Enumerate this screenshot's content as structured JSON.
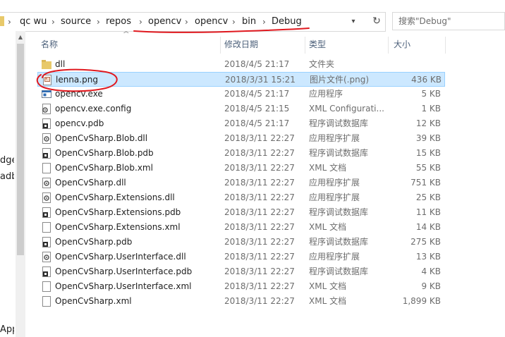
{
  "breadcrumb": [
    "qc wu",
    "source",
    "repos",
    "opencv",
    "opencv",
    "bin",
    "Debug"
  ],
  "search": {
    "placeholder": "搜索\"Debug\""
  },
  "left_pane": {
    "fragments": [
      "dge",
      "adb",
      "App"
    ]
  },
  "columns": {
    "name": "名称",
    "date": "修改日期",
    "type": "类型",
    "size": "大小"
  },
  "files": [
    {
      "name": "dll",
      "date": "2018/4/5 21:17",
      "type": "文件夹",
      "size": "",
      "icon": "folder-icon"
    },
    {
      "name": "lenna.png",
      "date": "2018/3/31 15:21",
      "type": "图片文件(.png)",
      "size": "436 KB",
      "icon": "image-file-icon",
      "selected": true
    },
    {
      "name": "opencv.exe",
      "date": "2018/4/5 21:17",
      "type": "应用程序",
      "size": "5 KB",
      "icon": "exe-icon"
    },
    {
      "name": "opencv.exe.config",
      "date": "2018/4/5 21:15",
      "type": "XML Configurati...",
      "size": "1 KB",
      "icon": "config-file-icon"
    },
    {
      "name": "opencv.pdb",
      "date": "2018/4/5 21:17",
      "type": "程序调试数据库",
      "size": "12 KB",
      "icon": "pdb-file-icon"
    },
    {
      "name": "OpenCvSharp.Blob.dll",
      "date": "2018/3/11 22:27",
      "type": "应用程序扩展",
      "size": "39 KB",
      "icon": "dll-file-icon"
    },
    {
      "name": "OpenCvSharp.Blob.pdb",
      "date": "2018/3/11 22:27",
      "type": "程序调试数据库",
      "size": "15 KB",
      "icon": "pdb-file-icon"
    },
    {
      "name": "OpenCvSharp.Blob.xml",
      "date": "2018/3/11 22:27",
      "type": "XML 文档",
      "size": "55 KB",
      "icon": "xml-file-icon"
    },
    {
      "name": "OpenCvSharp.dll",
      "date": "2018/3/11 22:27",
      "type": "应用程序扩展",
      "size": "751 KB",
      "icon": "dll-file-icon"
    },
    {
      "name": "OpenCvSharp.Extensions.dll",
      "date": "2018/3/11 22:27",
      "type": "应用程序扩展",
      "size": "25 KB",
      "icon": "dll-file-icon"
    },
    {
      "name": "OpenCvSharp.Extensions.pdb",
      "date": "2018/3/11 22:27",
      "type": "程序调试数据库",
      "size": "11 KB",
      "icon": "pdb-file-icon"
    },
    {
      "name": "OpenCvSharp.Extensions.xml",
      "date": "2018/3/11 22:27",
      "type": "XML 文档",
      "size": "14 KB",
      "icon": "xml-file-icon"
    },
    {
      "name": "OpenCvSharp.pdb",
      "date": "2018/3/11 22:27",
      "type": "程序调试数据库",
      "size": "275 KB",
      "icon": "pdb-file-icon"
    },
    {
      "name": "OpenCvSharp.UserInterface.dll",
      "date": "2018/3/11 22:27",
      "type": "应用程序扩展",
      "size": "13 KB",
      "icon": "dll-file-icon"
    },
    {
      "name": "OpenCvSharp.UserInterface.pdb",
      "date": "2018/3/11 22:27",
      "type": "程序调试数据库",
      "size": "4 KB",
      "icon": "pdb-file-icon"
    },
    {
      "name": "OpenCvSharp.UserInterface.xml",
      "date": "2018/3/11 22:27",
      "type": "XML 文档",
      "size": "9 KB",
      "icon": "xml-file-icon"
    },
    {
      "name": "OpenCvSharp.xml",
      "date": "2018/3/11 22:27",
      "type": "XML 文档",
      "size": "1,899 KB",
      "icon": "xml-file-icon"
    }
  ],
  "colors": {
    "selection_bg": "#cce8ff",
    "selection_border": "#99d1ff",
    "annotation_red": "#e0191f",
    "folder": "#e8c96a"
  }
}
